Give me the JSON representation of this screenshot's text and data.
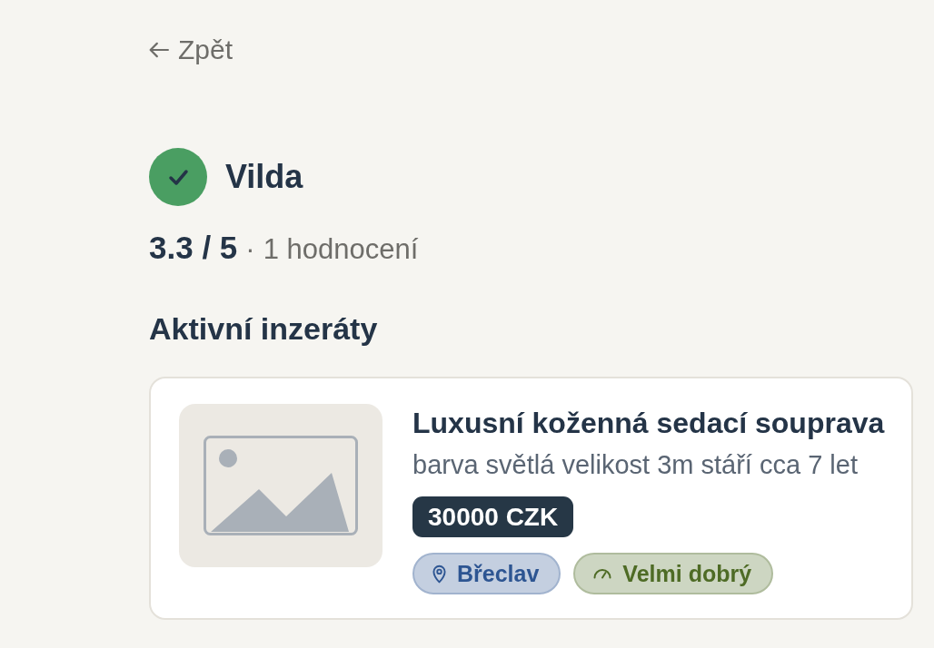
{
  "back_link": {
    "label": "Zpět"
  },
  "seller": {
    "name": "Vilda",
    "verified": true,
    "rating": {
      "score": "3.3 / 5",
      "separator": "·",
      "count": "1 hodnocení"
    }
  },
  "section_title": "Aktivní inzeráty",
  "listings": [
    {
      "title": "Luxusní koženná sedací souprava",
      "description": "barva světlá velikost 3m stáří cca 7 let",
      "price": "30000 CZK",
      "tags": [
        {
          "kind": "location",
          "label": "Břeclav",
          "color": "#2d5592"
        },
        {
          "kind": "condition",
          "label": "Velmi dobrý",
          "color": "#4e6b25"
        }
      ]
    }
  ]
}
